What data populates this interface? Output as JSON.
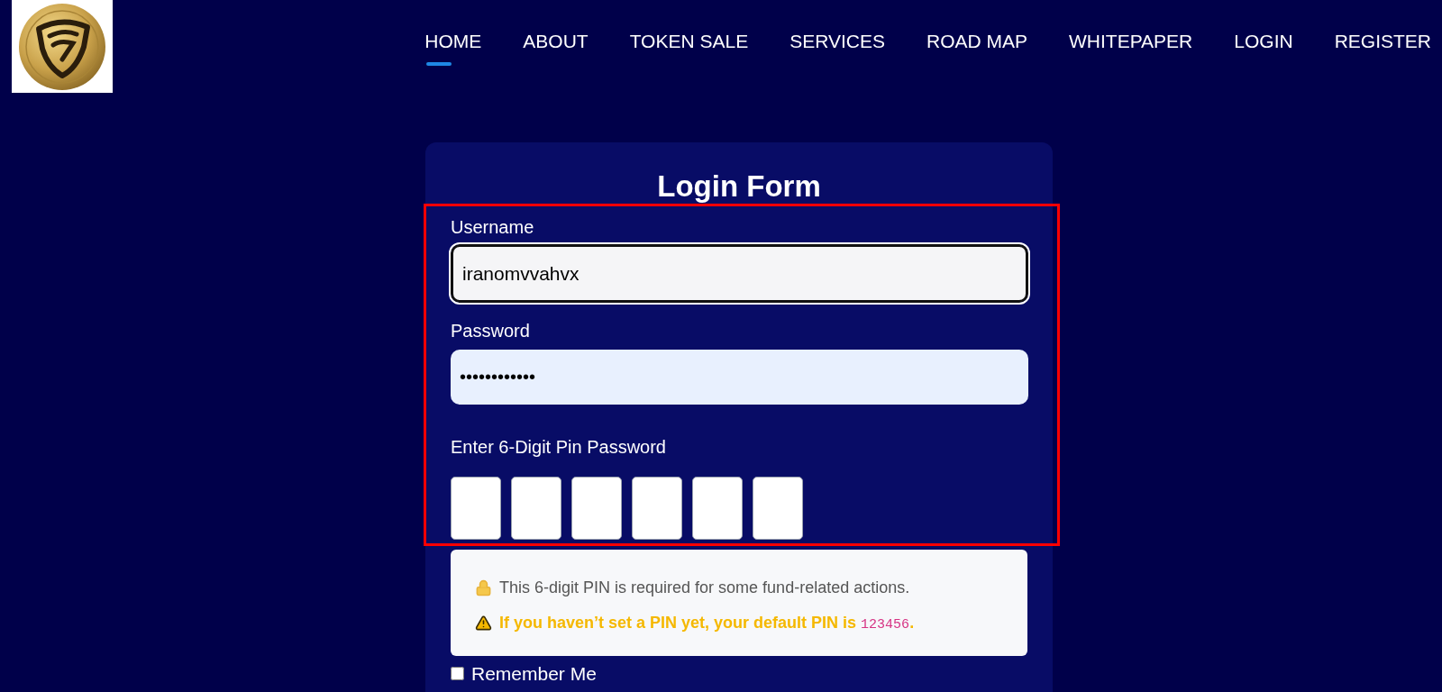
{
  "nav": [
    {
      "label": "HOME",
      "selected": true
    },
    {
      "label": "ABOUT",
      "selected": false
    },
    {
      "label": "TOKEN SALE",
      "selected": false
    },
    {
      "label": "SERVICES",
      "selected": false
    },
    {
      "label": "ROAD MAP",
      "selected": false
    },
    {
      "label": "WHITEPAPER",
      "selected": false
    },
    {
      "label": "LOGIN",
      "selected": false
    },
    {
      "label": "REGISTER",
      "selected": false
    }
  ],
  "form": {
    "title": "Login Form",
    "username": {
      "label": "Username",
      "value": "iranomvvahvx",
      "focused": true
    },
    "password": {
      "label": "Password",
      "value": "••••••••••••"
    },
    "pin": {
      "label": "Enter 6-Digit Pin Password",
      "boxes": [
        {
          "filled": false
        },
        {
          "filled": false
        },
        {
          "filled": false
        },
        {
          "filled": false
        },
        {
          "filled": false
        },
        {
          "filled": false
        }
      ]
    },
    "notice": {
      "info": "This 6-digit PIN is required for some fund-related actions.",
      "warning": "If you haven’t set a PIN yet, your default PIN is ",
      "code": "123456",
      "warning_end": "."
    },
    "remember": {
      "label": "Remember Me",
      "checked": false
    }
  }
}
